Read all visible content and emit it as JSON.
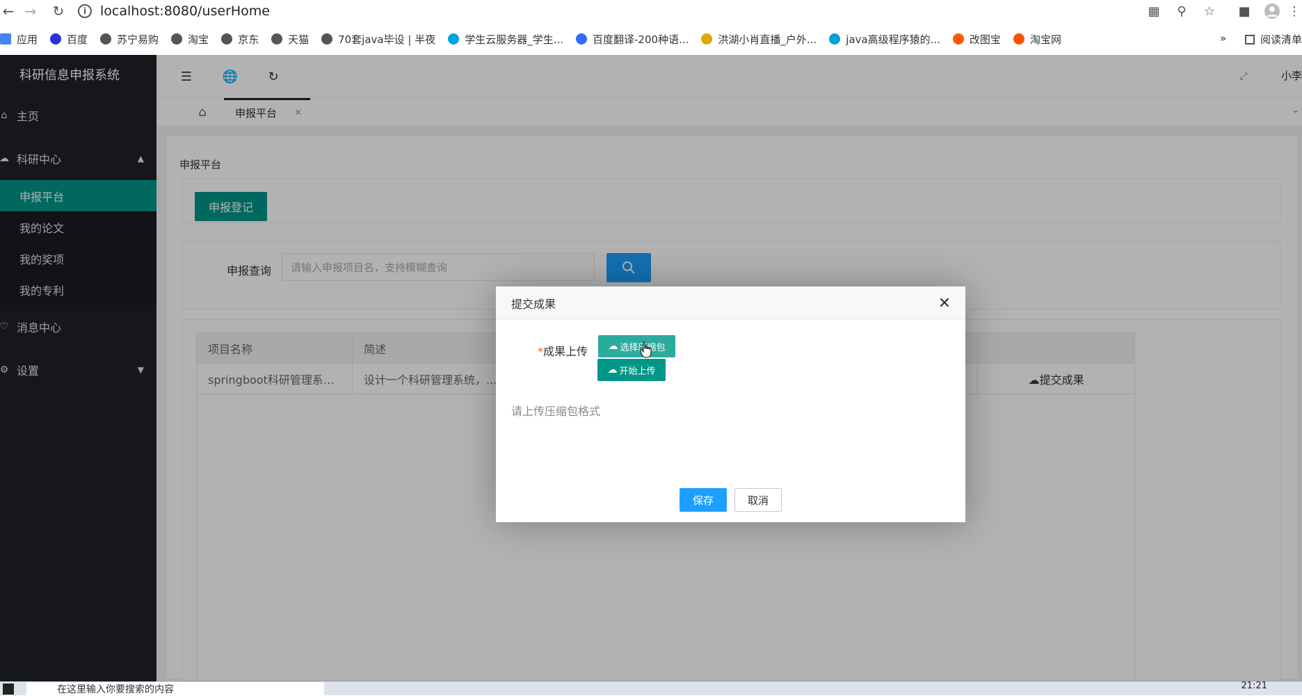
{
  "browser": {
    "url": "localhost:8080/userHome",
    "bookmarks": [
      {
        "label": "应用",
        "color": "#4285f4"
      },
      {
        "label": "百度",
        "color": "#2932e1"
      },
      {
        "label": "苏宁易购",
        "color": "#555555"
      },
      {
        "label": "淘宝",
        "color": "#555555"
      },
      {
        "label": "京东",
        "color": "#555555"
      },
      {
        "label": "天猫",
        "color": "#555555"
      },
      {
        "label": "70套java毕设 | 半夜",
        "color": "#555555"
      },
      {
        "label": "学生云服务器_学生...",
        "color": "#00a3e0"
      },
      {
        "label": "百度翻译-200种语...",
        "color": "#2f6bff"
      },
      {
        "label": "洪湖小肖直播_户外...",
        "color": "#e0a800"
      },
      {
        "label": "java高级程序猿的...",
        "color": "#00a1d6"
      },
      {
        "label": "改图宝",
        "color": "#ff5a00"
      },
      {
        "label": "淘宝网",
        "color": "#ff5000"
      }
    ],
    "more": "»",
    "reading_list": "阅读清单"
  },
  "sidebar": {
    "title": "科研信息申报系统",
    "items": [
      {
        "label": "主页",
        "icon": "home-icon"
      },
      {
        "label": "科研中心",
        "icon": "cloud-icon",
        "expanded": true,
        "children": [
          {
            "label": "申报平台",
            "active": true
          },
          {
            "label": "我的论文"
          },
          {
            "label": "我的奖项"
          },
          {
            "label": "我的专利"
          }
        ]
      },
      {
        "label": "消息中心",
        "icon": "bell-icon"
      },
      {
        "label": "设置",
        "icon": "gear-icon"
      }
    ]
  },
  "header": {
    "user": "小李"
  },
  "tabs": {
    "active": "申报平台"
  },
  "main": {
    "breadcrumb": "申报平台",
    "register_button": "申报登记",
    "search": {
      "label": "申报查询",
      "placeholder": "请输入申报项目名，支持模糊查询"
    },
    "table": {
      "columns": [
        "项目名称",
        "简述"
      ],
      "rows": [
        {
          "name": "springboot科研管理系统...",
          "desc": "设计一个科研管理系统，...",
          "action": "提交成果"
        }
      ]
    }
  },
  "modal": {
    "title": "提交成果",
    "required_mark": "*",
    "upload_label": "成果上传",
    "choose_button": "选择压缩包",
    "start_button": "开始上传",
    "hint": "请上传压缩包格式",
    "save": "保存",
    "cancel": "取消"
  },
  "taskbar": {
    "search_text": "在这里输入你要搜索的内容",
    "time": "21:21"
  },
  "colors": {
    "accent_green": "#009688",
    "accent_blue": "#1e9fff",
    "sidebar_bg": "#20222a"
  }
}
